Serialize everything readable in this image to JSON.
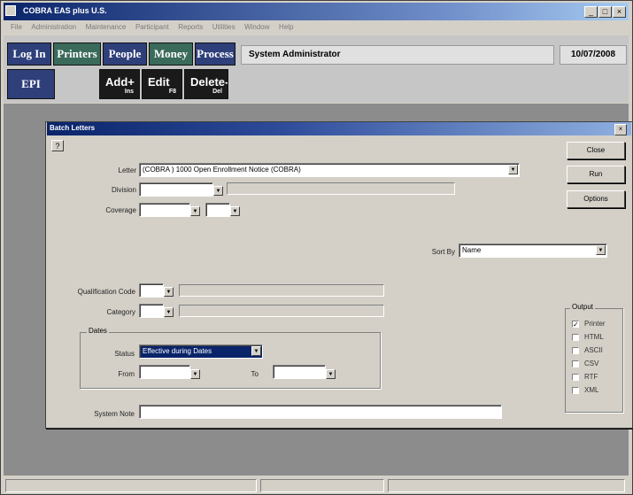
{
  "window": {
    "title": "COBRA EAS plus U.S."
  },
  "menu": [
    "File",
    "Administration",
    "Maintenance",
    "Participant",
    "Reports",
    "Utilities",
    "Window",
    "Help"
  ],
  "toolbar": {
    "log_in": "Log In",
    "printers": "Printers",
    "people": "People",
    "money": "Money",
    "process": "Process",
    "epi": "EPI",
    "add": "Add+",
    "add_key": "Ins",
    "edit": "Edit",
    "edit_key": "F8",
    "delete": "Delete-",
    "delete_key": "Del",
    "user": "System Administrator",
    "date": "10/07/2008"
  },
  "dialog": {
    "title": "Batch Letters",
    "help": "?",
    "close_label": "Close",
    "run_label": "Run",
    "options_label": "Options",
    "letter_label": "Letter",
    "letter_value": "(COBRA      ) 1000  Open Enrollment Notice (COBRA)",
    "division_label": "Division",
    "coverage_label": "Coverage",
    "sortby_label": "Sort By",
    "sortby_value": "Name",
    "qualification_label": "Qualification Code",
    "category_label": "Category",
    "dates_group": "Dates",
    "status_label": "Status",
    "status_value": "Effective during Dates",
    "from_label": "From",
    "to_label": "To",
    "system_note_label": "System Note",
    "output_group": "Output",
    "outputs": [
      {
        "label": "Printer",
        "checked": true
      },
      {
        "label": "HTML",
        "checked": false
      },
      {
        "label": "ASCII",
        "checked": false
      },
      {
        "label": "CSV",
        "checked": false
      },
      {
        "label": "RTF",
        "checked": false
      },
      {
        "label": "XML",
        "checked": false
      }
    ]
  }
}
